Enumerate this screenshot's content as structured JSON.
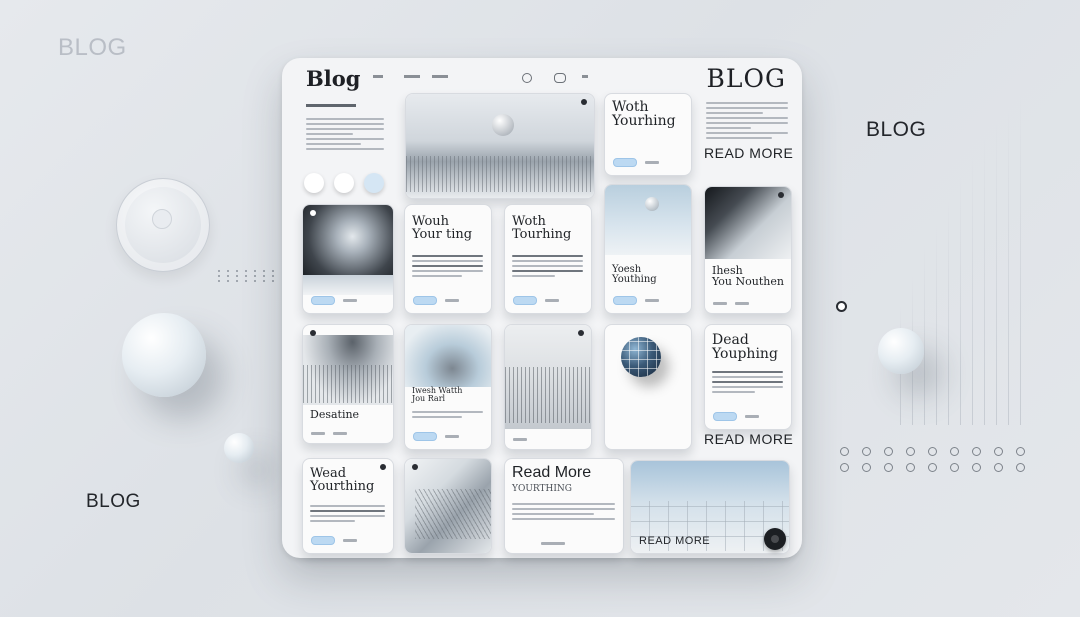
{
  "background": {
    "blog_top_left": "BLOG",
    "blog_right": "BLOG",
    "blog_bottom_left": "BLOG"
  },
  "panel": {
    "logo": "Blog",
    "title_right": "BLOG",
    "read_more_label": "READ MORE"
  },
  "cards": {
    "c1_title": "Woth\nYourhing",
    "c2_title": "Wouh\nYour ting",
    "c3_title": "Woth\nTourhing",
    "c4_title": "Yoesh\nYouthing",
    "c5_title": "Ihesh\nYou Nouthen",
    "c6_title": "Dead\nYouphing",
    "c7_title": "Desatine",
    "c8_title": "Iwesh Watth\nJou Rarl",
    "c9_title": "Wead\nYourthing",
    "c10_title": "Read More",
    "c10_subtitle": "YOURTHING"
  },
  "colors": {
    "accent": "#bcd9f2",
    "panel": "#f3f4f6",
    "ink": "#1f2226"
  }
}
